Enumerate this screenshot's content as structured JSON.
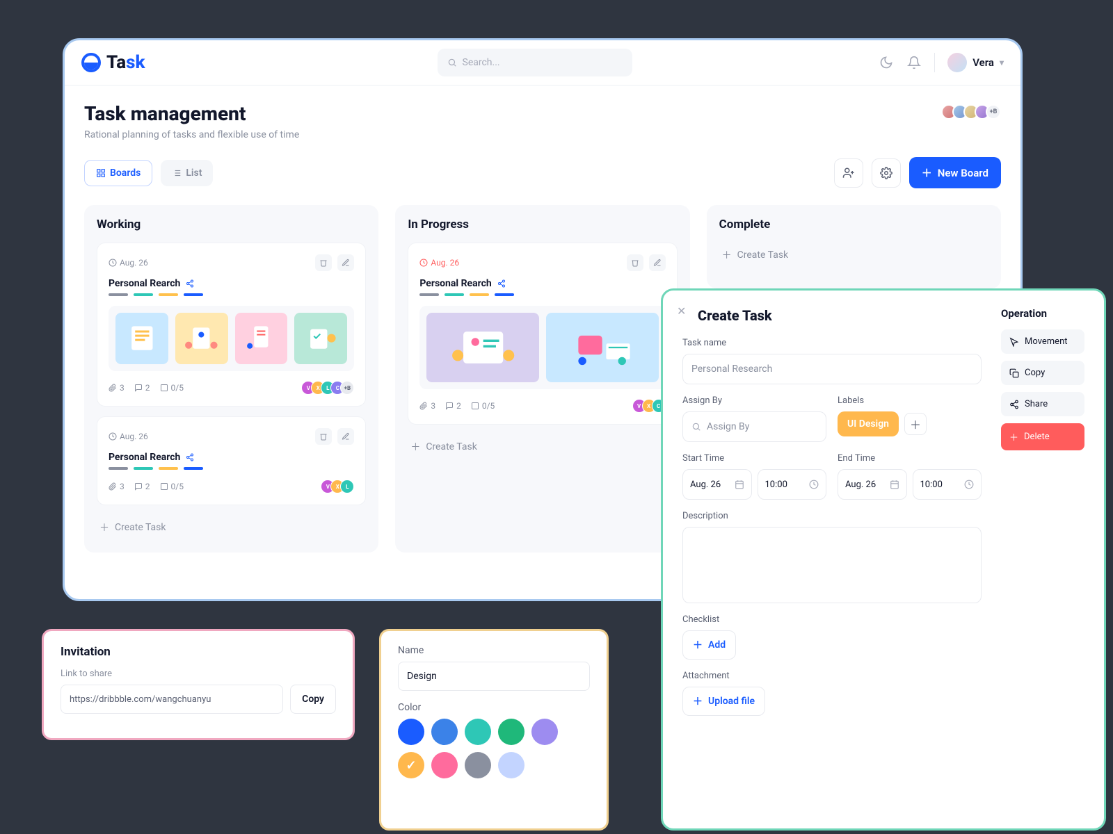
{
  "brand": {
    "part1": "Ta",
    "part2": "sk"
  },
  "search": {
    "placeholder": "Search..."
  },
  "user": {
    "name": "Vera"
  },
  "page": {
    "title": "Task management",
    "subtitle": "Rational planning of tasks and flexible use of time",
    "avatars_more": "+B"
  },
  "tabs": {
    "boards": "Boards",
    "list": "List"
  },
  "new_board_btn": "New Board",
  "columns": {
    "working": {
      "title": "Working"
    },
    "in_progress": {
      "title": "In Progress"
    },
    "complete": {
      "title": "Complete"
    }
  },
  "cards": {
    "c1": {
      "date": "Aug. 26",
      "title": "Personal Rearch",
      "attachments": "3",
      "comments": "2",
      "progress": "0/5",
      "avatars_more": "+B"
    },
    "c2": {
      "date": "Aug. 26",
      "title": "Personal Rearch",
      "attachments": "3",
      "comments": "2",
      "progress": "0/5"
    },
    "c3": {
      "date": "Aug. 26",
      "title": "Personal Rearch",
      "attachments": "3",
      "comments": "2",
      "progress": "0/5"
    }
  },
  "create_task_label": "Create Task",
  "create_panel": {
    "title": "Create Task",
    "task_name_label": "Task name",
    "task_name_placeholder": "Personal Research",
    "assign_label": "Assign By",
    "assign_placeholder": "Assign By",
    "labels_label": "Labels",
    "label_chip": "UI Design",
    "start_label": "Start Time",
    "end_label": "End Time",
    "start_date": "Aug. 26",
    "start_time": "10:00",
    "end_date": "Aug. 26",
    "end_time": "10:00",
    "description_label": "Description",
    "checklist_label": "Checklist",
    "add_btn": "Add",
    "attachment_label": "Attachment",
    "upload_btn": "Upload file",
    "operation_title": "Operation",
    "ops": {
      "movement": "Movement",
      "copy": "Copy",
      "share": "Share",
      "delete": "Delete"
    }
  },
  "invite": {
    "title": "Invitation",
    "label": "Link to share",
    "value": "https://dribbble.com/wangchuanyu",
    "copy": "Copy"
  },
  "color_picker": {
    "name_label": "Name",
    "name_value": "Design",
    "color_label": "Color",
    "swatches": [
      "#1a5cff",
      "#3b82e8",
      "#2ec7b6",
      "#1fb87a",
      "#9d8cf0",
      "#ffb84d",
      "#ff6b9d",
      "#8a909f",
      "#c3d4ff"
    ],
    "selected_index": 5
  }
}
